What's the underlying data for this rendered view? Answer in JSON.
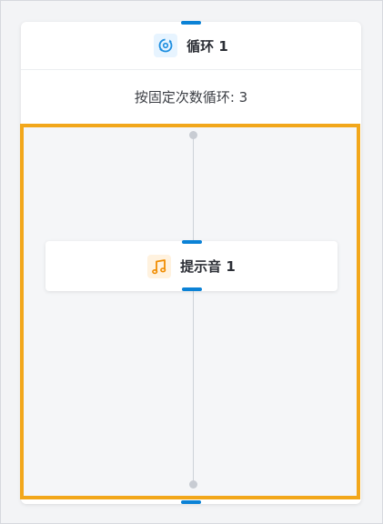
{
  "loop_block": {
    "icon": "loop-icon",
    "title": "循环 1",
    "description": "按固定次数循环: 3"
  },
  "inner_node": {
    "icon": "music-note-icon",
    "title": "提示音 1"
  },
  "colors": {
    "accent_blue": "#0b82d6",
    "highlight_orange": "#f2a71b",
    "music_orange": "#f08c00"
  }
}
